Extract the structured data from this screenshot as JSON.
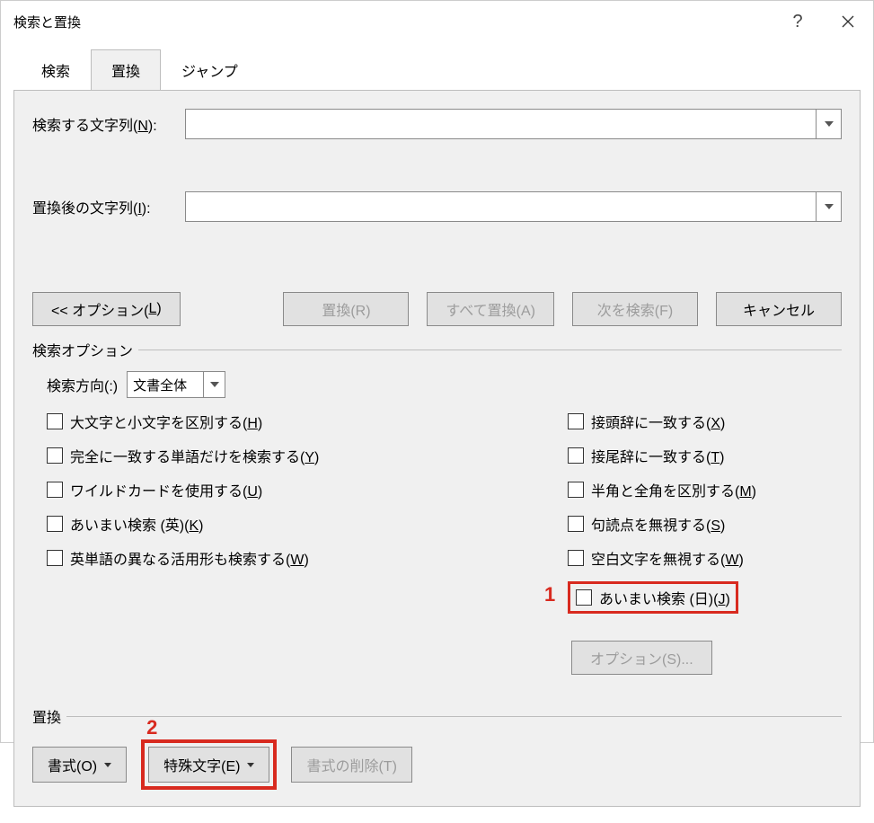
{
  "title": "検索と置換",
  "tabs": {
    "search": "検索",
    "replace": "置換",
    "jump": "ジャンプ"
  },
  "form": {
    "find_label_pre": "検索する文字列(",
    "find_key": "N",
    "find_label_post": "):",
    "replace_label_pre": "置換後の文字列(",
    "replace_key": "I",
    "replace_label_post": "):"
  },
  "buttons": {
    "options_pre": "<< オプション(",
    "options_key": "L",
    "options_post": ")",
    "replace": "置換(R)",
    "replace_all": "すべて置換(A)",
    "find_next": "次を検索(F)",
    "cancel": "キャンセル"
  },
  "search_options_title": "検索オプション",
  "dir_label": "検索方向(:)",
  "dir_value": "文書全体",
  "checks_left": [
    {
      "pre": "大文字と小文字を区別する(",
      "key": "H",
      "post": ")"
    },
    {
      "pre": "完全に一致する単語だけを検索する(",
      "key": "Y",
      "post": ")"
    },
    {
      "pre": "ワイルドカードを使用する(",
      "key": "U",
      "post": ")"
    },
    {
      "pre": "あいまい検索 (英)(",
      "key": "K",
      "post": ")"
    },
    {
      "pre": "英単語の異なる活用形も検索する(",
      "key": "W",
      "post": ")"
    }
  ],
  "checks_right": [
    {
      "pre": "接頭辞に一致する(",
      "key": "X",
      "post": ")"
    },
    {
      "pre": "接尾辞に一致する(",
      "key": "T",
      "post": ")"
    },
    {
      "pre": "半角と全角を区別する(",
      "key": "M",
      "post": ")"
    },
    {
      "pre": "句読点を無視する(",
      "key": "S",
      "post": ")"
    },
    {
      "pre": "空白文字を無視する(",
      "key": "W",
      "post": ")"
    }
  ],
  "fuzzy_jp": {
    "pre": "あいまい検索 (日)(",
    "key": "J",
    "post": ")"
  },
  "option_s": "オプション(S)...",
  "replace_section": "置換",
  "bottom": {
    "format_pre": "書式(",
    "format_key": "O",
    "format_post": ")",
    "special_pre": "特殊文字(",
    "special_key": "E",
    "special_post": ")",
    "clearfmt": "書式の削除(T)"
  },
  "anno1": "1",
  "anno2": "2"
}
